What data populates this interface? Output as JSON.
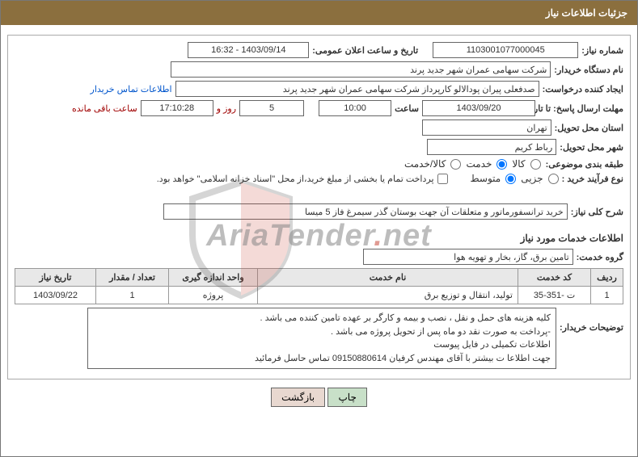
{
  "header": "جزئیات اطلاعات نیاز",
  "labels": {
    "need_number": "شماره نیاز:",
    "announce_datetime": "تاریخ و ساعت اعلان عمومی:",
    "buyer_org": "نام دستگاه خریدار:",
    "requester": "ایجاد کننده درخواست:",
    "buyer_contact": "اطلاعات تماس خریدار",
    "response_deadline": "مهلت ارسال پاسخ: تا تاریخ:",
    "hour": "ساعت",
    "days_and": "روز و",
    "remaining": "ساعت باقی مانده",
    "delivery_province": "استان محل تحویل:",
    "delivery_city": "شهر محل تحویل:",
    "subject_category": "طبقه بندی موضوعی:",
    "purchase_type": "نوع فرآیند خرید :",
    "partial_payment": "پرداخت تمام یا بخشی از مبلغ خرید،از محل \"اسناد خزانه اسلامی\" خواهد بود.",
    "summary": "شرح کلی نیاز:",
    "services_info": "اطلاعات خدمات مورد نیاز",
    "service_group": "گروه خدمت:",
    "buyer_notes": "توضیحات خریدار:"
  },
  "fields": {
    "need_number": "1103001077000045",
    "announce_datetime": "1403/09/14 - 16:32",
    "buyer_org": "شرکت سهامی عمران شهر جدید پرند",
    "requester": "صدفعلی پیران پودالالو کارپرداز شرکت سهامی عمران شهر جدید پرند",
    "response_date": "1403/09/20",
    "response_hour": "10:00",
    "days_left": "5",
    "time_left": "17:10:28",
    "delivery_province": "تهران",
    "delivery_city": "رباط کریم",
    "summary": "خرید ترانسفورماتور و متعلقات آن جهت بوستان گذر سیمرغ فاز 5 میسا",
    "service_group": "تامین برق، گاز، بخار و تهویه هوا",
    "buyer_notes_l1": "کلیه هزینه های حمل و نقل ، نصب و بیمه و کارگر بر عهده تامین کننده  می باشد .",
    "buyer_notes_l2": "-پرداخت به صورت نقد دو ماه پس از تحویل پروژه  می باشد .",
    "buyer_notes_l3": "اطلاعات تکمیلی در فایل پیوست",
    "buyer_notes_l4": "جهت اطلاعا ت بیشتر با آقای مهندس کرفیان  09150880614 تماس حاسل فرمائید"
  },
  "radios": {
    "cat_goods": "کالا",
    "cat_service": "خدمت",
    "cat_goods_service": "کالا/خدمت",
    "type_minor": "جزیی",
    "type_medium": "متوسط"
  },
  "table": {
    "headers": {
      "row": "ردیف",
      "code": "کد خدمت",
      "name": "نام خدمت",
      "unit": "واحد اندازه گیری",
      "qty": "تعداد / مقدار",
      "date": "تاریخ نیاز"
    },
    "rows": [
      {
        "row": "1",
        "code": "ت -351-35",
        "name": "تولید، انتقال و توزیع برق",
        "unit": "پروژه",
        "qty": "1",
        "date": "1403/09/22"
      }
    ]
  },
  "buttons": {
    "print": "چاپ",
    "back": "بازگشت"
  },
  "watermark": "AriaTender.net"
}
